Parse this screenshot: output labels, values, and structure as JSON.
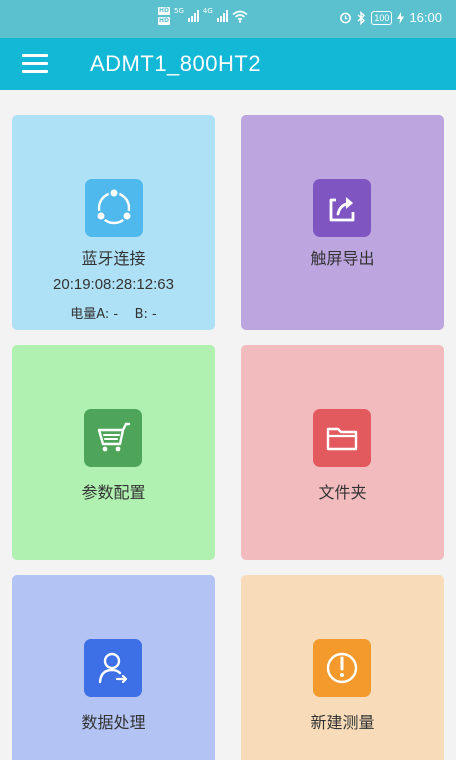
{
  "status_bar": {
    "hd1": "HD",
    "hd2": "HD",
    "net1": "5G",
    "net2": "4G",
    "battery": "100",
    "time": "16:00"
  },
  "toolbar": {
    "title": "ADMT1_800HT2"
  },
  "cards": [
    {
      "label": "蓝牙连接",
      "address": "20:19:08:28:12:63",
      "battery_info": "电量A: -    B: -",
      "color": "#aee1f6",
      "icon_color": "#4fb8ec"
    },
    {
      "label": "触屏导出",
      "color": "#bda6e0",
      "icon_color": "#7f55c2"
    },
    {
      "label": "参数配置",
      "color": "#b0f1b1",
      "icon_color": "#4ea559"
    },
    {
      "label": "文件夹",
      "color": "#f2bcbf",
      "icon_color": "#e35a5e"
    },
    {
      "label": "数据处理",
      "color": "#b3c3f4",
      "icon_color": "#3d6fe6"
    },
    {
      "label": "新建测量",
      "color": "#f8dcb9",
      "icon_color": "#f49a2c"
    }
  ]
}
